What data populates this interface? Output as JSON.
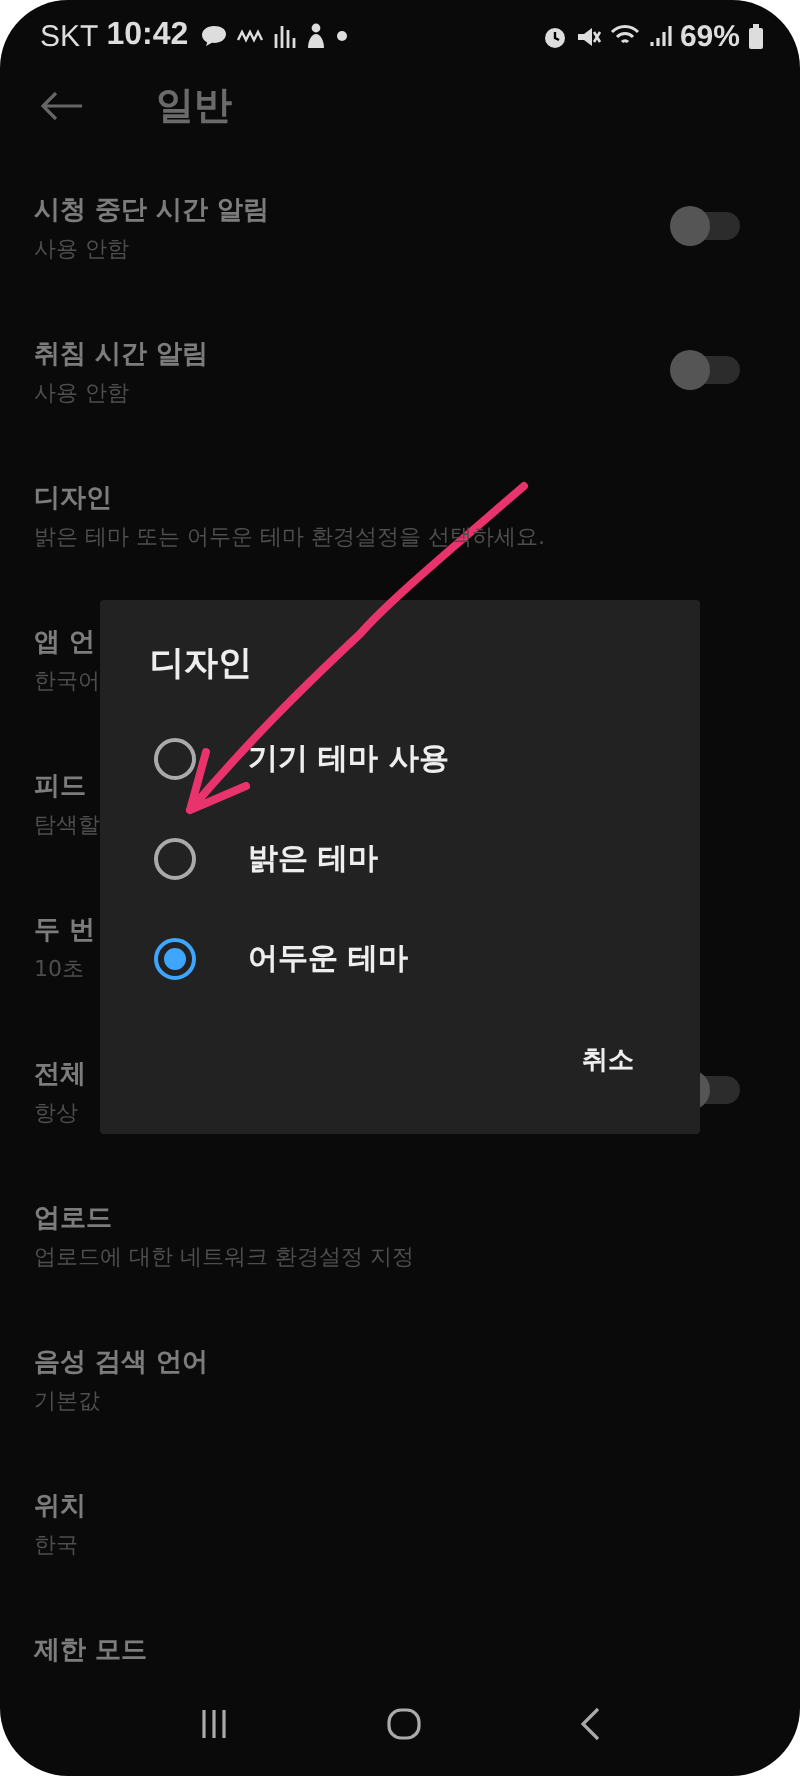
{
  "status_bar": {
    "carrier": "SKT",
    "time": "10:42",
    "battery": "69%"
  },
  "header": {
    "title": "일반"
  },
  "settings": [
    {
      "title": "시청 중단 시간 알림",
      "subtitle": "사용 안함",
      "kind": "toggle",
      "on": false
    },
    {
      "title": "취침 시간 알림",
      "subtitle": "사용 안함",
      "kind": "toggle",
      "on": false
    },
    {
      "title": "디자인",
      "subtitle": "밝은 테마 또는 어두운 테마 환경설정을 선택하세요.",
      "kind": "text"
    },
    {
      "title": "앱 언",
      "subtitle": "한국어",
      "kind": "text"
    },
    {
      "title": "피드",
      "subtitle": "탐색할",
      "kind": "text"
    },
    {
      "title": "두 번",
      "subtitle": "10초",
      "kind": "text"
    },
    {
      "title": "전체",
      "subtitle": "항상",
      "kind": "toggle",
      "on": false
    },
    {
      "title": "업로드",
      "subtitle": "업로드에 대한 네트워크 환경설정 지정",
      "kind": "text"
    },
    {
      "title": "음성 검색 언어",
      "subtitle": "기본값",
      "kind": "text"
    },
    {
      "title": "위치",
      "subtitle": "한국",
      "kind": "text"
    },
    {
      "title": "제한 모드",
      "kind": "text"
    }
  ],
  "dialog": {
    "title": "디자인",
    "options": [
      {
        "label": "기기 테마 사용",
        "selected": false
      },
      {
        "label": "밝은 테마",
        "selected": false
      },
      {
        "label": "어두운 테마",
        "selected": true
      }
    ],
    "cancel": "취소"
  }
}
